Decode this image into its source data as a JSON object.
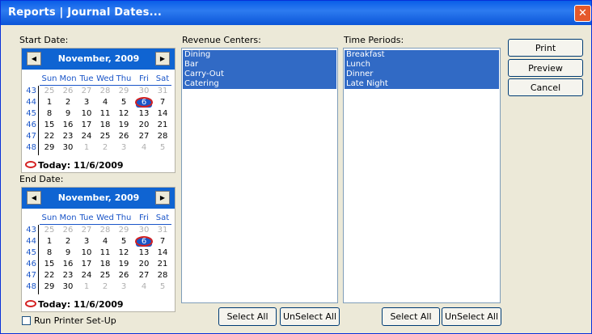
{
  "window": {
    "title": "Reports  |  Journal Dates..."
  },
  "close_glyph": "✕",
  "start_date": {
    "label": "Start Date:",
    "month_label": "November, 2009",
    "prev_glyph": "◀",
    "next_glyph": "▶",
    "dow": [
      "Sun",
      "Mon",
      "Tue",
      "Wed",
      "Thu",
      "Fri",
      "Sat"
    ],
    "weeks": [
      "43",
      "44",
      "45",
      "46",
      "47",
      "48"
    ],
    "days": [
      [
        "25",
        "26",
        "27",
        "28",
        "29",
        "30",
        "31"
      ],
      [
        "1",
        "2",
        "3",
        "4",
        "5",
        "6",
        "7"
      ],
      [
        "8",
        "9",
        "10",
        "11",
        "12",
        "13",
        "14"
      ],
      [
        "15",
        "16",
        "17",
        "18",
        "19",
        "20",
        "21"
      ],
      [
        "22",
        "23",
        "24",
        "25",
        "26",
        "27",
        "28"
      ],
      [
        "29",
        "30",
        "1",
        "2",
        "3",
        "4",
        "5"
      ]
    ],
    "selected_day": "6",
    "today_label": "Today: 11/6/2009"
  },
  "end_date": {
    "label": "End Date:",
    "month_label": "November, 2009",
    "prev_glyph": "◀",
    "next_glyph": "▶",
    "dow": [
      "Sun",
      "Mon",
      "Tue",
      "Wed",
      "Thu",
      "Fri",
      "Sat"
    ],
    "weeks": [
      "43",
      "44",
      "45",
      "46",
      "47",
      "48"
    ],
    "days": [
      [
        "25",
        "26",
        "27",
        "28",
        "29",
        "30",
        "31"
      ],
      [
        "1",
        "2",
        "3",
        "4",
        "5",
        "6",
        "7"
      ],
      [
        "8",
        "9",
        "10",
        "11",
        "12",
        "13",
        "14"
      ],
      [
        "15",
        "16",
        "17",
        "18",
        "19",
        "20",
        "21"
      ],
      [
        "22",
        "23",
        "24",
        "25",
        "26",
        "27",
        "28"
      ],
      [
        "29",
        "30",
        "1",
        "2",
        "3",
        "4",
        "5"
      ]
    ],
    "selected_day": "6",
    "today_label": "Today: 11/6/2009"
  },
  "revenue_centers": {
    "label": "Revenue Centers:",
    "items": [
      "Dining",
      "Bar",
      "Carry-Out",
      "Catering"
    ],
    "select_all": "Select All",
    "unselect_all": "UnSelect All"
  },
  "time_periods": {
    "label": "Time Periods:",
    "items": [
      "Breakfast",
      "Lunch",
      "Dinner",
      "Late Night"
    ],
    "select_all": "Select All",
    "unselect_all": "UnSelect All"
  },
  "actions": {
    "print": "Print",
    "preview": "Preview",
    "cancel": "Cancel"
  },
  "printer_setup": {
    "label": "Run Printer Set-Up",
    "checked": false
  },
  "colors": {
    "title_bar": "#0f64d2",
    "selection": "#316ac5",
    "calendar_header": "#0f64d2"
  }
}
